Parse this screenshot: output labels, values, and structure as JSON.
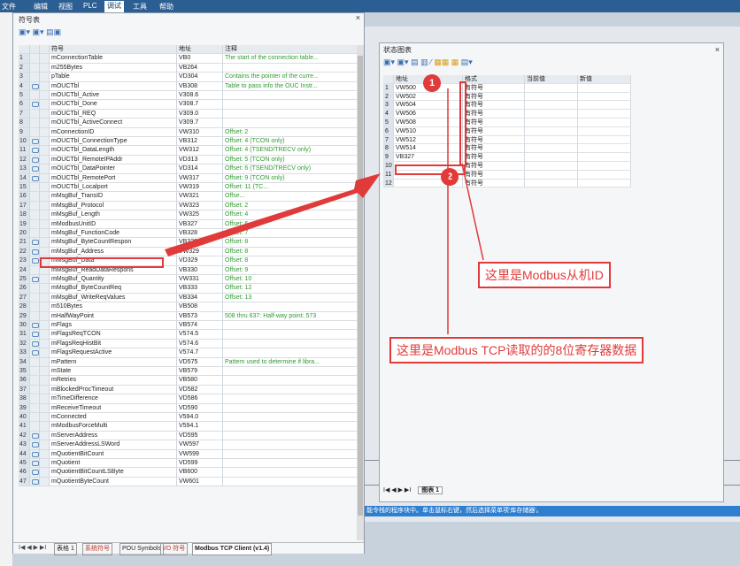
{
  "menu": [
    "文件",
    "编辑",
    "视图",
    "PLC",
    "调试",
    "工具",
    "帮助"
  ],
  "symbol_window": {
    "title": "符号表",
    "close": "×",
    "columns": {
      "symbol": "符号",
      "address": "地址",
      "comment": "注释"
    },
    "rows": [
      {
        "n": "1",
        "symbol": "mConnectionTable",
        "address": "VB0",
        "comment": "The start of the connection table..."
      },
      {
        "n": "2",
        "symbol": "m255Bytes",
        "address": "VB264",
        "comment": ""
      },
      {
        "n": "3",
        "symbol": "pTable",
        "address": "VD304",
        "comment": "Contains the pointer of the curre..."
      },
      {
        "n": "4",
        "symbol": "mOUCTbl",
        "address": "VB308",
        "comment": "Table to pass info the OUC Instr..."
      },
      {
        "n": "5",
        "symbol": "mOUCTbl_Active",
        "address": "V308.6",
        "comment": ""
      },
      {
        "n": "6",
        "symbol": "mOUCTbl_Done",
        "address": "V308.7",
        "comment": ""
      },
      {
        "n": "7",
        "symbol": "mOUCTbl_REQ",
        "address": "V309.0",
        "comment": ""
      },
      {
        "n": "8",
        "symbol": "mOUCTbl_ActiveConnect",
        "address": "V309.7",
        "comment": ""
      },
      {
        "n": "9",
        "symbol": "mConnectionID",
        "address": "VW310",
        "comment": "Offset: 2"
      },
      {
        "n": "10",
        "symbol": "mOUCTbl_ConnectionType",
        "address": "VB312",
        "comment": "Offset: 4 (TCON only)"
      },
      {
        "n": "11",
        "symbol": "mOUCTbl_DataLength",
        "address": "VW312",
        "comment": "Offset: 4 (TSEND/TRECV only)"
      },
      {
        "n": "12",
        "symbol": "mOUCTbl_RemoteIPAddr",
        "address": "VD313",
        "comment": "Offset: 5 (TCON only)"
      },
      {
        "n": "13",
        "symbol": "mOUCTbl_DataPointer",
        "address": "VD314",
        "comment": "Offset: 6 (TSEND/TRECV only)"
      },
      {
        "n": "14",
        "symbol": "mOUCTbl_RemotePort",
        "address": "VW317",
        "comment": "Offset: 9 (TCON only)"
      },
      {
        "n": "15",
        "symbol": "mOUCTbl_Localport",
        "address": "VW319",
        "comment": "Offset: 11 (TC..."
      },
      {
        "n": "16",
        "symbol": "mMsgBuf_TransID",
        "address": "VW321",
        "comment": "Offse..."
      },
      {
        "n": "17",
        "symbol": "mMsgBuf_Protocol",
        "address": "VW323",
        "comment": "Offset: 2"
      },
      {
        "n": "18",
        "symbol": "mMsgBuf_Length",
        "address": "VW325",
        "comment": "Offset: 4"
      },
      {
        "n": "19",
        "symbol": "mModbusUnitID",
        "address": "VB327",
        "comment": "Offset: 6"
      },
      {
        "n": "20",
        "symbol": "mMsgBuf_FunctionCode",
        "address": "VB328",
        "comment": "Offset: 7"
      },
      {
        "n": "21",
        "symbol": "mMsgBuf_ByteCountRespon",
        "address": "VB329",
        "comment": "Offset: 8"
      },
      {
        "n": "22",
        "symbol": "mMsgBuf_Address",
        "address": "VW329",
        "comment": "Offset: 8"
      },
      {
        "n": "23",
        "symbol": "mMsgBuf_Data",
        "address": "VD329",
        "comment": "Offset: 8"
      },
      {
        "n": "24",
        "symbol": "mMsgBuf_ReadDataRespons",
        "address": "VB330",
        "comment": "Offset: 9"
      },
      {
        "n": "25",
        "symbol": "mMsgBuf_Quantity",
        "address": "VW331",
        "comment": "Offset: 10"
      },
      {
        "n": "26",
        "symbol": "mMsgBuf_ByteCountReq",
        "address": "VB333",
        "comment": "Offset: 12"
      },
      {
        "n": "27",
        "symbol": "mMsgBuf_WriteReqValues",
        "address": "VB334",
        "comment": "Offset: 13"
      },
      {
        "n": "28",
        "symbol": "m510Bytes",
        "address": "VB508",
        "comment": ""
      },
      {
        "n": "29",
        "symbol": "mHalfWayPoint",
        "address": "VB573",
        "comment": "508 thru 637: Half-way point: 573"
      },
      {
        "n": "30",
        "symbol": "mFlags",
        "address": "VB574",
        "comment": ""
      },
      {
        "n": "31",
        "symbol": "mFlagsReqTCON",
        "address": "V574.5",
        "comment": ""
      },
      {
        "n": "32",
        "symbol": "mFlagsReqHistBit",
        "address": "V574.6",
        "comment": ""
      },
      {
        "n": "33",
        "symbol": "mFlagsRequestActive",
        "address": "V574.7",
        "comment": ""
      },
      {
        "n": "34",
        "symbol": "mPattern",
        "address": "VD575",
        "comment": "Pattern used to determine if libra..."
      },
      {
        "n": "35",
        "symbol": "mState",
        "address": "VB579",
        "comment": ""
      },
      {
        "n": "36",
        "symbol": "mRetries",
        "address": "VB580",
        "comment": ""
      },
      {
        "n": "37",
        "symbol": "mBlockedProcTimeout",
        "address": "VD582",
        "comment": ""
      },
      {
        "n": "38",
        "symbol": "mTimeDifference",
        "address": "VD586",
        "comment": ""
      },
      {
        "n": "39",
        "symbol": "mReceiveTimeout",
        "address": "VD590",
        "comment": ""
      },
      {
        "n": "40",
        "symbol": "mConnected",
        "address": "V594.0",
        "comment": ""
      },
      {
        "n": "41",
        "symbol": "mModbusForceMulti",
        "address": "V594.1",
        "comment": ""
      },
      {
        "n": "42",
        "symbol": "mServerAddress",
        "address": "VD595",
        "comment": ""
      },
      {
        "n": "43",
        "symbol": "mServerAddressLSWord",
        "address": "VW597",
        "comment": ""
      },
      {
        "n": "44",
        "symbol": "mQuotientBitCount",
        "address": "VW599",
        "comment": ""
      },
      {
        "n": "45",
        "symbol": "mQuotient",
        "address": "VD599",
        "comment": ""
      },
      {
        "n": "46",
        "symbol": "mQuotientBitCountLSByte",
        "address": "VB600",
        "comment": ""
      },
      {
        "n": "47",
        "symbol": "mQuotientByteCount",
        "address": "VW601",
        "comment": ""
      }
    ],
    "tabs": [
      "表格 1",
      "系统符号",
      "POU Symbols",
      "I/O 符号",
      "Modbus TCP Client (v1.4)"
    ],
    "tab_nav": "I◀ ◀ ▶ ▶I"
  },
  "status_window": {
    "title": "状态图表",
    "close": "×",
    "columns": {
      "address": "地址",
      "format": "格式",
      "current": "当前值",
      "new": "新值"
    },
    "rows": [
      {
        "n": "1",
        "address": "VW500",
        "format": "有符号"
      },
      {
        "n": "2",
        "address": "VW502",
        "format": "有符号"
      },
      {
        "n": "3",
        "address": "VW504",
        "format": "有符号"
      },
      {
        "n": "4",
        "address": "VW506",
        "format": "有符号"
      },
      {
        "n": "5",
        "address": "VW508",
        "format": "有符号"
      },
      {
        "n": "6",
        "address": "VW510",
        "format": "有符号"
      },
      {
        "n": "7",
        "address": "VW512",
        "format": "有符号"
      },
      {
        "n": "8",
        "address": "VW514",
        "format": "有符号"
      },
      {
        "n": "9",
        "address": "VB327",
        "format": "有符号"
      },
      {
        "n": "10",
        "address": "",
        "format": "有符号"
      },
      {
        "n": "11",
        "address": "",
        "format": "有符号"
      },
      {
        "n": "12",
        "address": "",
        "format": "有符号"
      }
    ],
    "tab": "图表 1",
    "tab_nav": "I◀ ◀ ▶ ▶I"
  },
  "annotations": {
    "marker1": "1",
    "marker2": "2",
    "callout_unit_id": "这里是Modbus从机ID",
    "callout_registers": "这里是Modbus TCP读取的的8位寄存器数据"
  },
  "status_bar_text": "能令栈的程序块中。单击鼠标右键，然后选择菜单项'库存储器'。",
  "colors": {
    "annotation_red": "#e03a3a",
    "menubar_blue": "#2b5f93",
    "comment_green": "#2f9b2f"
  }
}
